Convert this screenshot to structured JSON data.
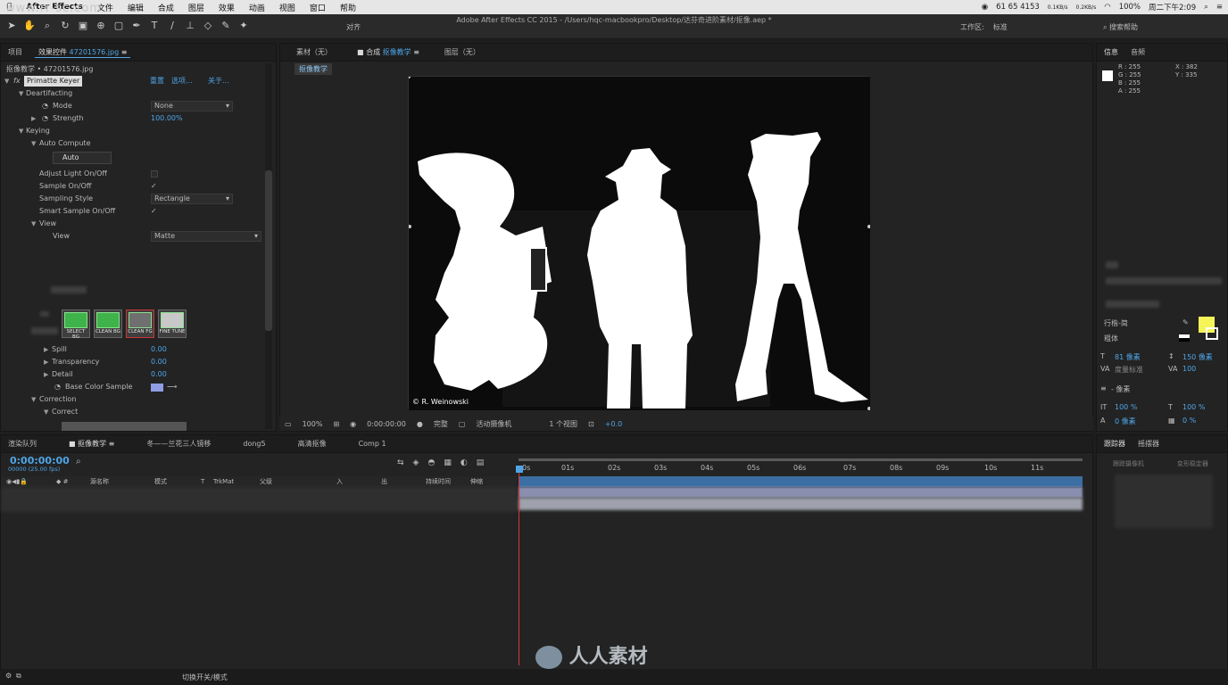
{
  "menubar": {
    "app": "After Effects",
    "items": [
      "文件",
      "编辑",
      "合成",
      "图层",
      "效果",
      "动画",
      "视图",
      "窗口",
      "帮助"
    ],
    "status_items": [
      "61 65 4153",
      "0.1KB/s",
      "0.2KB/s",
      "100%",
      "周二下午2:09"
    ]
  },
  "watermark_top": "www.rr-sc.com",
  "toolbar": {
    "window_title": "Adobe After Effects CC 2015 - /Users/hqc-macbookpro/Desktop/达芬奇进阶素材/抠像.aep *",
    "align_label": "对齐",
    "workspace_label": "工作区:",
    "workspace_value": "标准",
    "search_placeholder": "搜索帮助"
  },
  "effect_panel": {
    "tab_project": "项目",
    "tab_effects": "效果控件",
    "tab_effects_file": "47201576.jpg",
    "subtitle": "抠像教学 • 47201576.jpg",
    "effect_name": "Primatte Keyer",
    "reset": "重置",
    "options": "选项...",
    "about": "关于...",
    "deartifacting": "Deartifacting",
    "mode_label": "Mode",
    "mode_value": "None",
    "strength_label": "Strength",
    "strength_value": "100.00%",
    "keying": "Keying",
    "auto_compute": "Auto Compute",
    "auto_button": "Auto",
    "adjust_light": "Adjust Light On/Off",
    "sample_onoff": "Sample On/Off",
    "sampling_style": "Sampling Style",
    "sampling_value": "Rectangle",
    "smart_sample": "Smart Sample On/Off",
    "view": "View",
    "view_label": "View",
    "view_value": "Matte",
    "btn_select_bg": "SELECT BG",
    "btn_clean_bg": "CLEAN BG",
    "btn_clean_fg": "CLEAN FG",
    "btn_fine_tune": "FINE TUNE",
    "spill": "Spill",
    "spill_value": "0.00",
    "transparency": "Transparency",
    "transparency_value": "0.00",
    "detail": "Detail",
    "detail_value": "0.00",
    "base_color": "Base Color Sample",
    "base_color_hex": "#8f9de6",
    "correction": "Correction",
    "correct": "Correct"
  },
  "composition": {
    "tab_footage": "素材（无）",
    "tab_comp": "合成",
    "tab_comp_name": "抠像教学",
    "tab_layer": "图层（无）",
    "breadcrumb": "抠像教学",
    "credit": "© R. Weinowski",
    "zoom": "100%",
    "timecode": "0:00:00:00",
    "resolution": "完整",
    "camera": "活动摄像机",
    "views": "1 个视图",
    "exposure": "+0.0"
  },
  "info": {
    "tab_info": "信息",
    "tab_audio": "音频",
    "r": "R : 255",
    "g": "G : 255",
    "b": "B : 255",
    "a": "A : 255",
    "x": "X : 382",
    "y": "Y : 335",
    "swatch_color": "#f5f55a",
    "font_family": "行楷-简",
    "font_style": "粗体",
    "font_size": "81 像素",
    "leading": "150 像素",
    "kerning": "度量标准",
    "tracking": "100",
    "indent": "- 像素",
    "v_scale": "100 %",
    "h_scale": "100 %",
    "baseline": "0 像素",
    "tsume": "0 %"
  },
  "timeline": {
    "tabs": [
      "渲染队列",
      "抠像教学",
      "冬——兰花三人镜移",
      "dong5",
      "高清抠像",
      "Comp 1"
    ],
    "timecode": "0:00:00:00",
    "fps": "00000 (25.00 fps)",
    "col_source": "源名称",
    "col_mode": "模式",
    "col_t": "T",
    "col_trkmat": "TrkMat",
    "col_parent": "父级",
    "col_in": "入",
    "col_out": "出",
    "col_duration": "持续时间",
    "col_stretch": "伸缩",
    "ruler": [
      "0s",
      "01s",
      "02s",
      "03s",
      "04s",
      "05s",
      "06s",
      "07s",
      "08s",
      "09s",
      "10s",
      "11s"
    ],
    "footer_toggle": "切换开关/模式"
  },
  "tracker": {
    "tab_tracker": "跟踪器",
    "tab_wiggler": "摇摆器",
    "track_camera": "跟踪摄像机",
    "warp_stabilizer": "变形稳定器"
  },
  "brand_watermark": "人人素材"
}
